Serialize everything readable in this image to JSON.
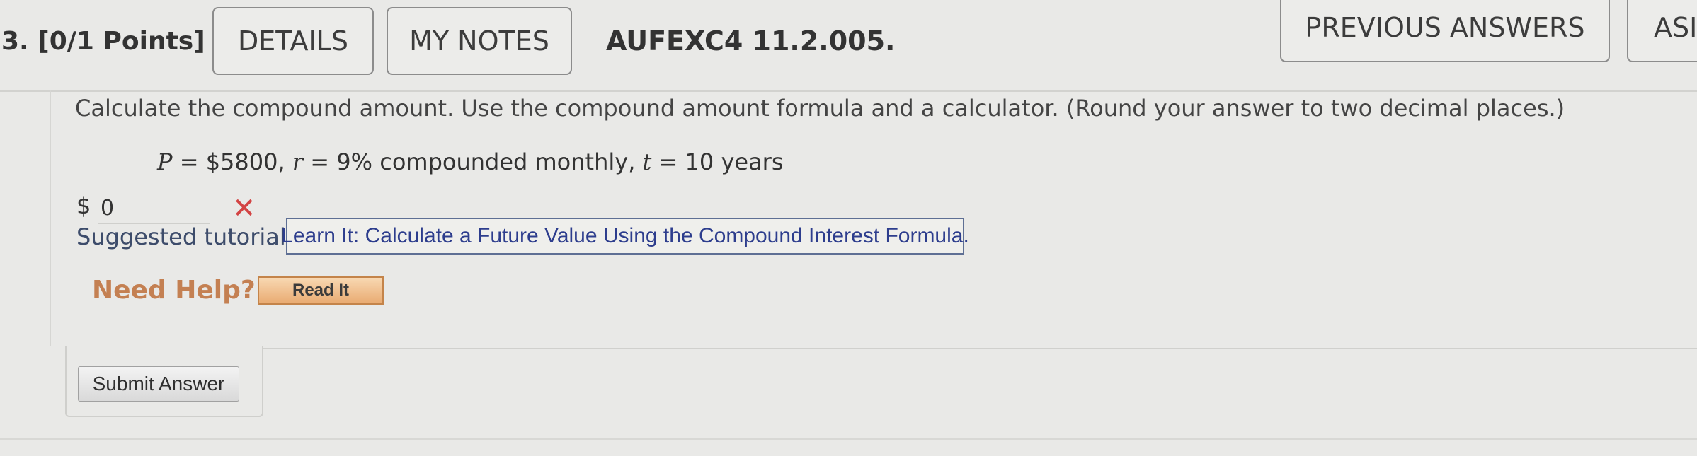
{
  "header": {
    "question_label": "3. [0/1 Points]",
    "details_label": "DETAILS",
    "my_notes_label": "MY NOTES",
    "question_id": "AUFEXC4 11.2.005.",
    "previous_answers_label": "PREVIOUS ANSWERS",
    "ask_label": "ASI"
  },
  "question": {
    "instructions": "Calculate the compound amount. Use the compound amount formula and a calculator. (Round your answer to two decimal places.)",
    "given": {
      "p_var": "P",
      "p_text": " = $5800, ",
      "r_var": "r",
      "r_text": " = 9% compounded monthly, ",
      "t_var": "t",
      "t_text": " = 10 years"
    },
    "currency_symbol": "$",
    "answer_value": "0",
    "status_icon": "x-icon"
  },
  "tutorial": {
    "label": "Suggested tutorial:",
    "link_text": "Learn It: Calculate a Future Value Using the Compound Interest Formula."
  },
  "help": {
    "label": "Need Help?",
    "read_it_label": "Read It"
  },
  "submit": {
    "label": "Submit Answer"
  },
  "colors": {
    "background": "#e9e9e7",
    "error": "#d34444",
    "link": "#2d3d8d",
    "help": "#c48052"
  }
}
